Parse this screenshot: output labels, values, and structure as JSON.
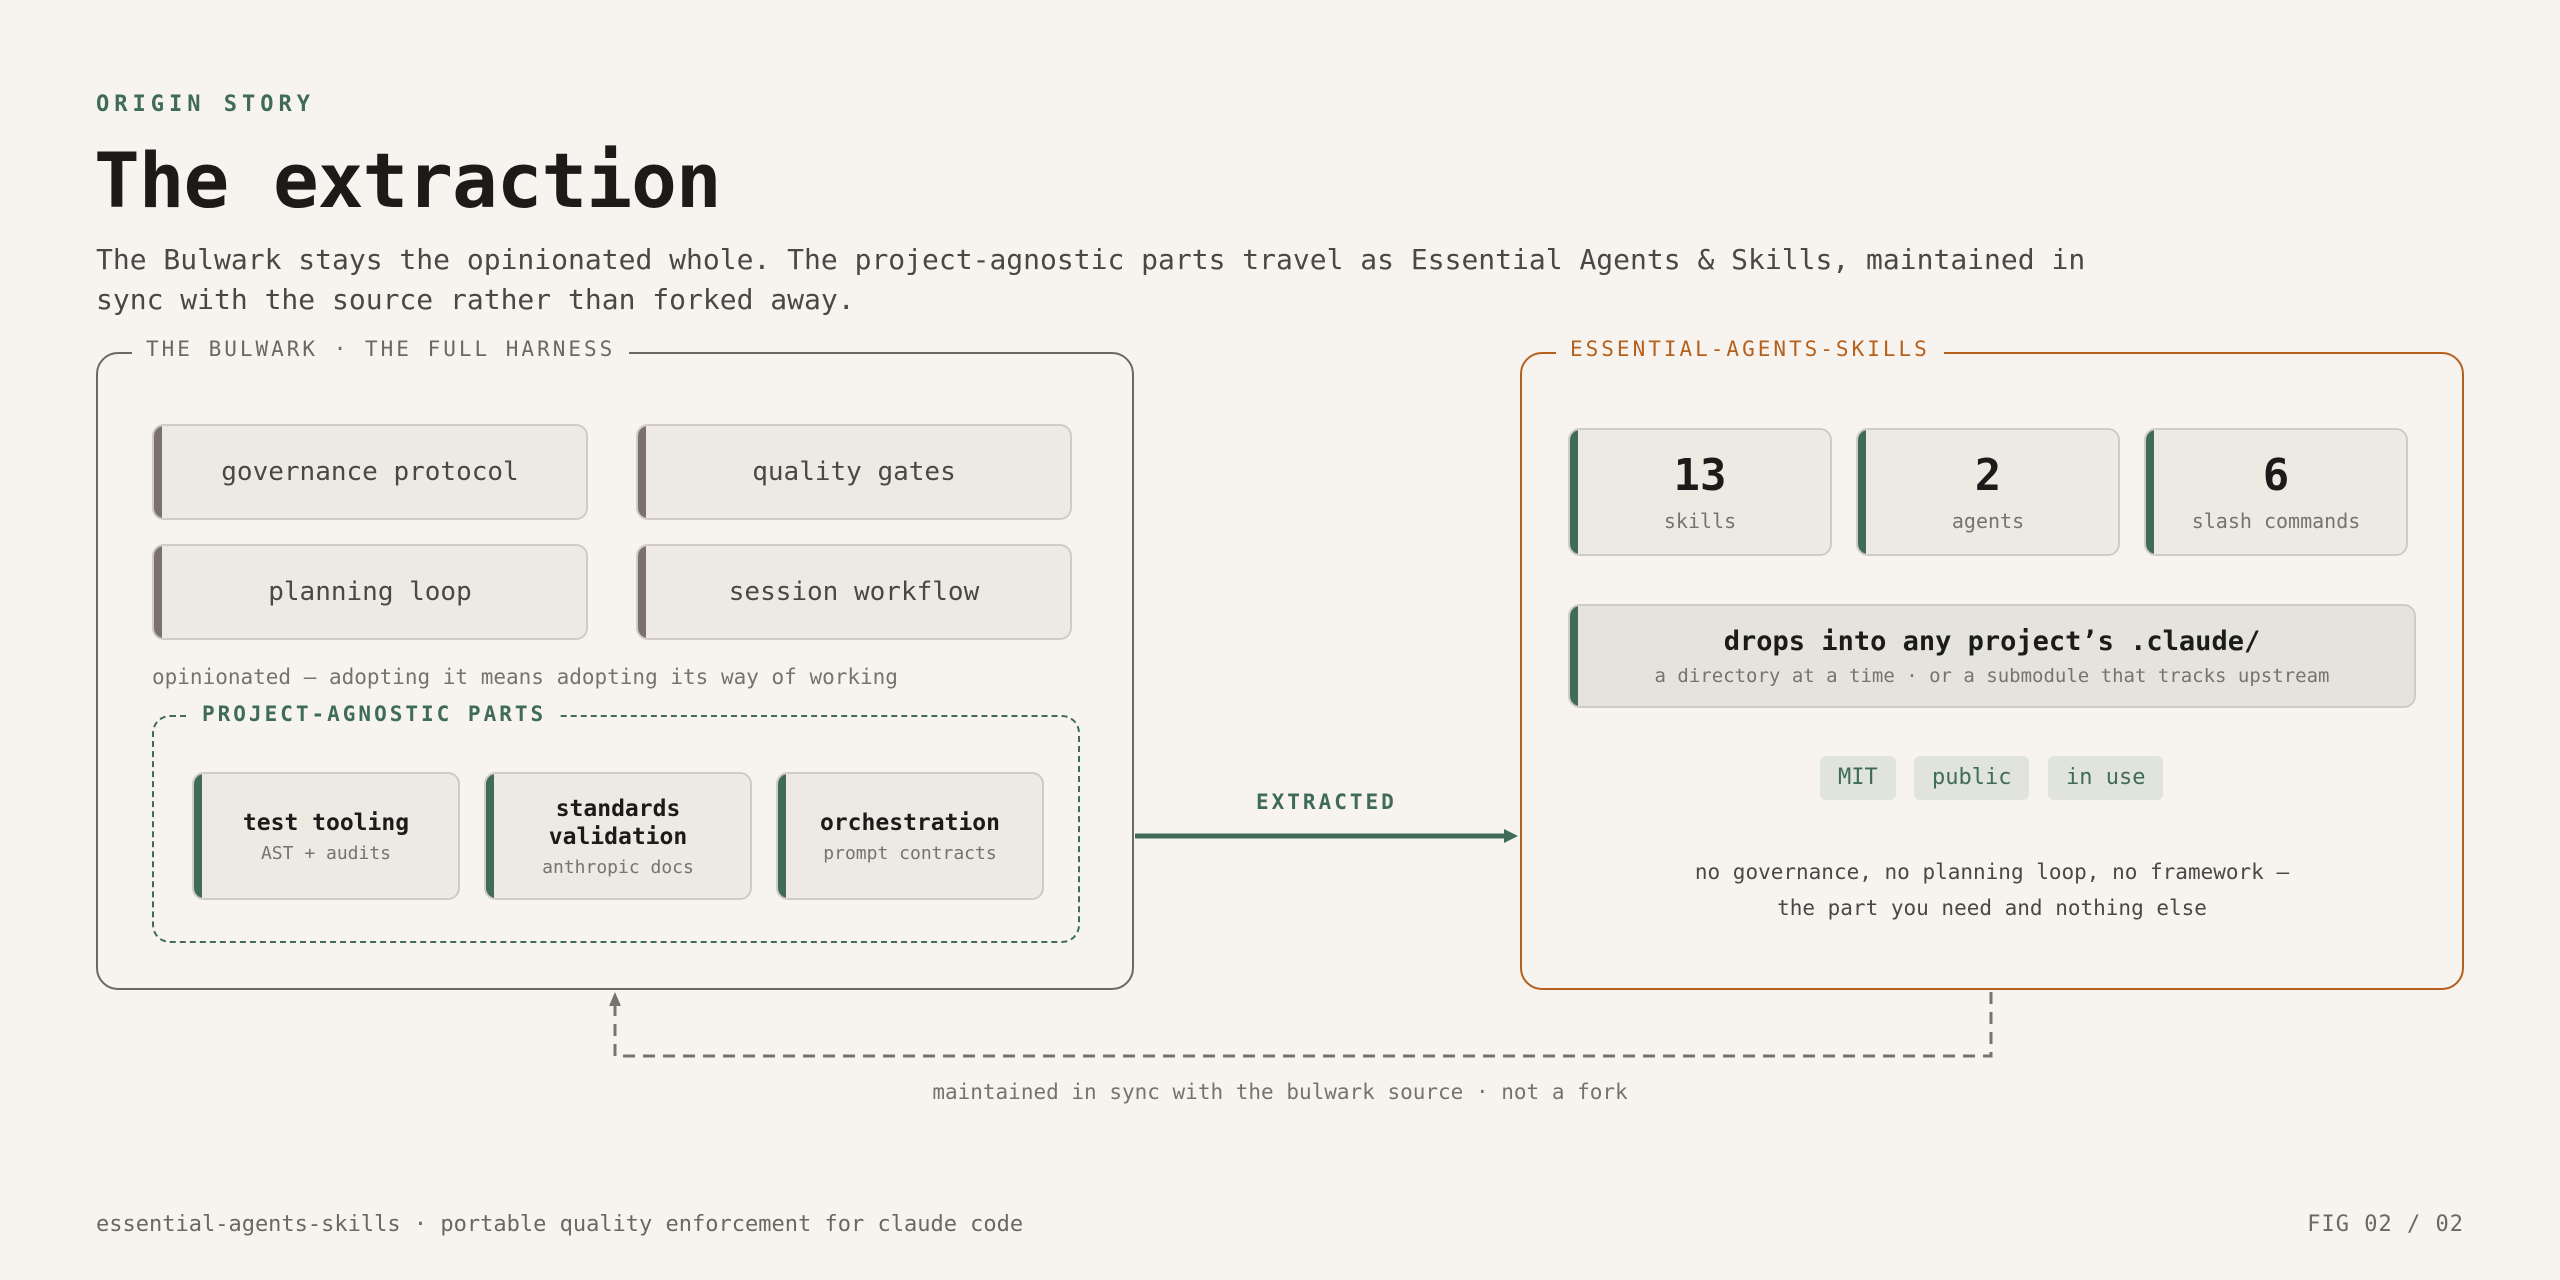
{
  "header": {
    "eyebrow": "ORIGIN STORY",
    "title": "The extraction",
    "lead": "The Bulwark stays the opinionated whole. The project-agnostic parts travel as Essential Agents & Skills, maintained in sync with the source rather than forked away."
  },
  "bulwark": {
    "legend": "THE BULWARK · THE FULL HARNESS",
    "cards": [
      "governance protocol",
      "quality gates",
      "planning loop",
      "session workflow"
    ],
    "note": "opinionated — adopting it means adopting its way of working",
    "agnostic": {
      "legend": "PROJECT-AGNOSTIC PARTS",
      "items": [
        {
          "title": "test tooling",
          "sub": "AST + audits"
        },
        {
          "title": "standards validation",
          "sub": "anthropic docs"
        },
        {
          "title": "orchestration",
          "sub": "prompt contracts"
        }
      ]
    }
  },
  "connector": {
    "extracted_label": "EXTRACTED",
    "sync_label": "maintained in sync with the bulwark source · not a fork"
  },
  "essential": {
    "legend": "ESSENTIAL-AGENTS-SKILLS",
    "stats": [
      {
        "value": "13",
        "label": "skills"
      },
      {
        "value": "2",
        "label": "agents"
      },
      {
        "value": "6",
        "label": "slash commands"
      }
    ],
    "drops": {
      "title": "drops into any project’s .claude/",
      "sub": "a directory at a time · or a submodule that tracks upstream"
    },
    "tags": [
      "MIT",
      "public",
      "in use"
    ],
    "note_line1": "no governance, no planning loop, no framework —",
    "note_line2": "the part you need and nothing else"
  },
  "footer": {
    "left": "essential-agents-skills · portable quality enforcement for claude code",
    "right": "FIG 02 / 02"
  },
  "colors": {
    "accent_green": "#3f6b58",
    "accent_orange": "#b5601c",
    "background": "#f7f4ef"
  }
}
